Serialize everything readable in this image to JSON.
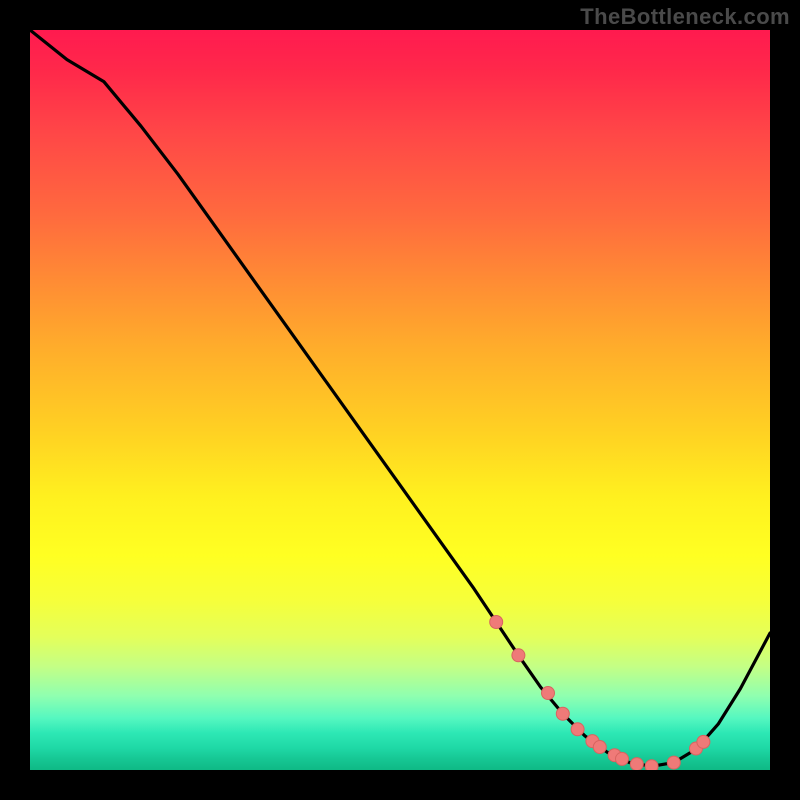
{
  "watermark": "TheBottleneck.com",
  "colors": {
    "page_bg": "#000000",
    "curve": "#000000",
    "marker_fill": "#ef7a78",
    "marker_stroke": "#d86460",
    "gradient_top": "#ff1a4f",
    "gradient_bottom": "#0fb985"
  },
  "chart_data": {
    "type": "line",
    "title": "",
    "xlabel": "",
    "ylabel": "",
    "xlim": [
      0,
      100
    ],
    "ylim": [
      0,
      100
    ],
    "grid": false,
    "legend": false,
    "series": [
      {
        "name": "bottleneck-curve",
        "x": [
          0,
          5,
          10,
          15,
          20,
          25,
          30,
          35,
          40,
          45,
          50,
          55,
          60,
          63,
          66,
          69,
          72,
          75,
          78,
          81,
          84,
          87,
          90,
          93,
          96,
          100
        ],
        "values": [
          100,
          96,
          93,
          87,
          80.5,
          73.5,
          66.5,
          59.5,
          52.5,
          45.5,
          38.5,
          31.5,
          24.5,
          20,
          15.5,
          11.2,
          7.6,
          4.6,
          2.4,
          1.0,
          0.5,
          1.0,
          2.8,
          6.2,
          11,
          18.5
        ]
      }
    ],
    "markers": {
      "name": "highlight-points",
      "x": [
        63,
        66,
        70,
        72,
        74,
        76,
        77,
        79,
        80,
        82,
        84,
        87,
        90,
        91
      ],
      "values": [
        20,
        15.5,
        10.4,
        7.6,
        5.5,
        3.9,
        3.1,
        2.0,
        1.5,
        0.8,
        0.5,
        1.0,
        2.9,
        3.8
      ]
    }
  }
}
